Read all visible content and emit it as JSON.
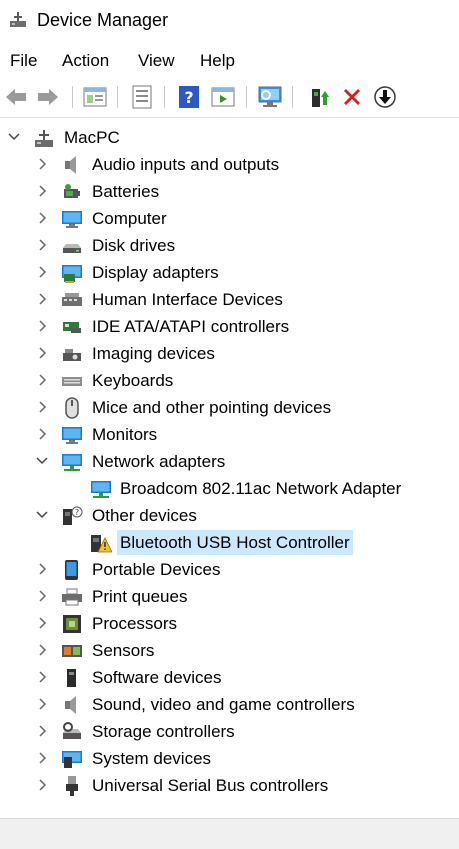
{
  "window": {
    "title": "Device Manager"
  },
  "menu": {
    "file": "File",
    "action": "Action",
    "view": "View",
    "help": "Help"
  },
  "toolbar": {
    "buttons": [
      "back-arrow-icon",
      "forward-arrow-icon",
      "properties-icon",
      "device-list-icon",
      "help-icon",
      "run-icon",
      "monitor-scan-icon",
      "update-driver-icon",
      "uninstall-icon",
      "disable-icon"
    ]
  },
  "tree": {
    "root": "MacPC",
    "categories": {
      "audio": "Audio inputs and outputs",
      "batteries": "Batteries",
      "computer": "Computer",
      "disk": "Disk drives",
      "display": "Display adapters",
      "hid": "Human Interface Devices",
      "ide": "IDE ATA/ATAPI controllers",
      "imaging": "Imaging devices",
      "keyboards": "Keyboards",
      "mice": "Mice and other pointing devices",
      "monitors": "Monitors",
      "network": "Network adapters",
      "network_child": "Broadcom 802.11ac Network Adapter",
      "other": "Other devices",
      "other_child": "Bluetooth USB Host Controller",
      "portable": "Portable Devices",
      "print": "Print queues",
      "processors": "Processors",
      "sensors": "Sensors",
      "software": "Software devices",
      "sound": "Sound, video and game controllers",
      "storage": "Storage controllers",
      "system": "System devices",
      "usb": "Universal Serial Bus controllers"
    }
  },
  "colors": {
    "selection": "#cce8ff",
    "accent_blue": "#1e78d4",
    "error_red": "#d81e1e",
    "warning_yellow": "#f2c12e"
  }
}
